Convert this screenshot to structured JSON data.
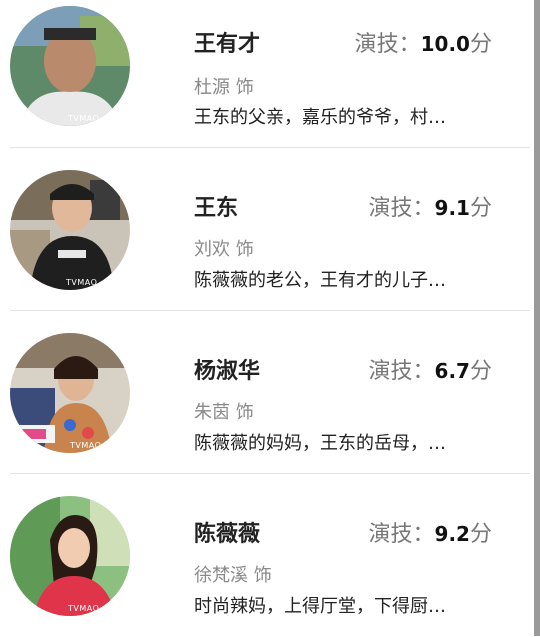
{
  "characters": [
    {
      "name": "王有才",
      "score_label": "演技：",
      "score": "10.0",
      "score_unit": "分",
      "actor": "杜源 饰",
      "desc": "王东的父亲，嘉乐的爷爷，村…",
      "watermark": "TVMAO"
    },
    {
      "name": "王东",
      "score_label": "演技：",
      "score": "9.1",
      "score_unit": "分",
      "actor": "刘欢 饰",
      "desc": "陈薇薇的老公，王有才的儿子…",
      "watermark": "TVMAO"
    },
    {
      "name": "杨淑华",
      "score_label": "演技：",
      "score": "6.7",
      "score_unit": "分",
      "actor": "朱茵 饰",
      "desc": "陈薇薇的妈妈，王东的岳母，…",
      "watermark": "TVMAO"
    },
    {
      "name": "陈薇薇",
      "score_label": "演技：",
      "score": "9.2",
      "score_unit": "分",
      "actor": "徐梵溪 饰",
      "desc": "时尚辣妈，上得厅堂，下得厨…",
      "watermark": "TVMAO"
    }
  ],
  "icons": [
    "avatar-photo"
  ]
}
